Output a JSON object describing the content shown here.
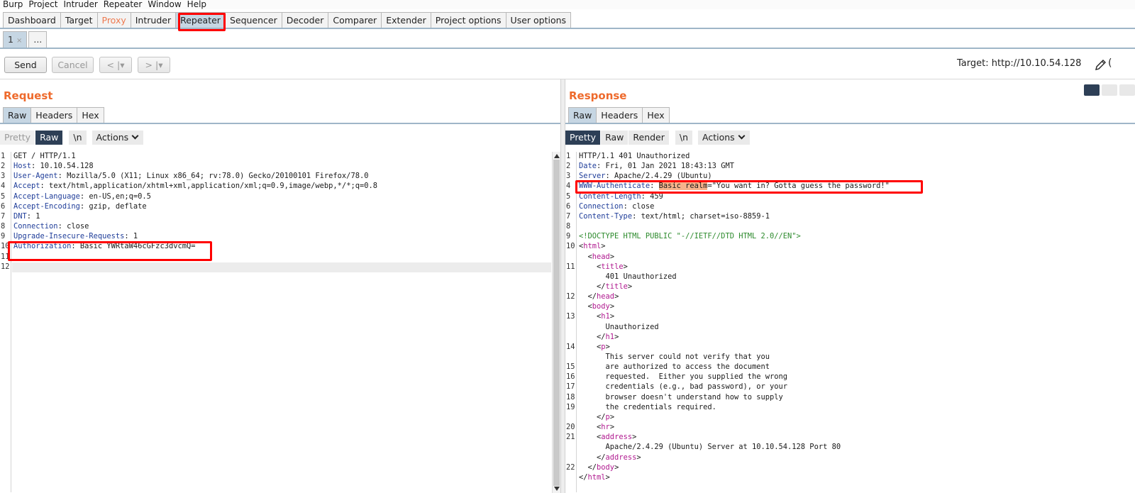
{
  "menubar": [
    "Burp",
    "Project",
    "Intruder",
    "Repeater",
    "Window",
    "Help"
  ],
  "main_tabs": [
    "Dashboard",
    "Target",
    "Proxy",
    "Intruder",
    "Repeater",
    "Sequencer",
    "Decoder",
    "Comparer",
    "Extender",
    "Project options",
    "User options"
  ],
  "sub_tabs": {
    "first": "1",
    "first_close": "×",
    "more": "..."
  },
  "toolbar": {
    "send": "Send",
    "cancel": "Cancel",
    "back": "< |▾",
    "forward": "> |▾",
    "target": "Target: http://10.10.54.128",
    "paren": "("
  },
  "request": {
    "title": "Request",
    "tabs": [
      "Raw",
      "Headers",
      "Hex"
    ],
    "view": {
      "pretty": "Pretty",
      "raw": "Raw",
      "newline": "\\n",
      "actions": "Actions"
    },
    "lines": [
      {
        "n": "1",
        "k": "",
        "v": "GET / HTTP/1.1"
      },
      {
        "n": "2",
        "k": "Host",
        "v": ": 10.10.54.128"
      },
      {
        "n": "3",
        "k": "User-Agent",
        "v": ": Mozilla/5.0 (X11; Linux x86_64; rv:78.0) Gecko/20100101 Firefox/78.0"
      },
      {
        "n": "4",
        "k": "Accept",
        "v": ": text/html,application/xhtml+xml,application/xml;q=0.9,image/webp,*/*;q=0.8"
      },
      {
        "n": "5",
        "k": "Accept-Language",
        "v": ": en-US,en;q=0.5"
      },
      {
        "n": "6",
        "k": "Accept-Encoding",
        "v": ": gzip, deflate"
      },
      {
        "n": "7",
        "k": "DNT",
        "v": ": 1"
      },
      {
        "n": "8",
        "k": "Connection",
        "v": ": close"
      },
      {
        "n": "9",
        "k": "Upgrade-Insecure-Requests",
        "v": ": 1"
      },
      {
        "n": "10",
        "k": "Authorization",
        "v": ": Basic YWRtaW46cGFzc3dvcmQ="
      },
      {
        "n": "11",
        "k": "",
        "v": ""
      },
      {
        "n": "12",
        "k": "",
        "v": ""
      }
    ]
  },
  "response": {
    "title": "Response",
    "tabs": [
      "Raw",
      "Headers",
      "Hex"
    ],
    "view": {
      "pretty": "Pretty",
      "raw": "Raw",
      "render": "Render",
      "newline": "\\n",
      "actions": "Actions"
    },
    "lines": [
      {
        "n": "1",
        "k": "",
        "v": "HTTP/1.1 401 Unauthorized"
      },
      {
        "n": "2",
        "k": "Date",
        "v": ": Fri, 01 Jan 2021 18:43:13 GMT"
      },
      {
        "n": "3",
        "k": "Server",
        "v": ": Apache/2.4.29 (Ubuntu)"
      },
      {
        "n": "4",
        "k": "WWW-Authenticate",
        "v": ": ",
        "mark": "Basic realm",
        "rest": "=\"You want in? Gotta guess the password!\""
      },
      {
        "n": "5",
        "k": "Content-Length",
        "v": ": 459"
      },
      {
        "n": "6",
        "k": "Connection",
        "v": ": close"
      },
      {
        "n": "7",
        "k": "Content-Type",
        "v": ": text/html; charset=iso-8859-1"
      },
      {
        "n": "8",
        "k": "",
        "v": ""
      },
      {
        "n": "9",
        "doc": "<!DOCTYPE HTML PUBLIC \"-//IETF//DTD HTML 2.0//EN\">"
      },
      {
        "n": "10",
        "ind": "",
        "open": "html"
      },
      {
        "n": "",
        "ind": "  ",
        "open": "head"
      },
      {
        "n": "11",
        "ind": "    ",
        "open": "title"
      },
      {
        "n": "",
        "ind": "      ",
        "text": "401 Unauthorized"
      },
      {
        "n": "",
        "ind": "    ",
        "close": "title"
      },
      {
        "n": "12",
        "ind": "  ",
        "close": "head"
      },
      {
        "n": "",
        "ind": "  ",
        "open": "body"
      },
      {
        "n": "13",
        "ind": "    ",
        "open": "h1"
      },
      {
        "n": "",
        "ind": "      ",
        "text": "Unauthorized"
      },
      {
        "n": "",
        "ind": "    ",
        "close": "h1"
      },
      {
        "n": "14",
        "ind": "    ",
        "open": "p"
      },
      {
        "n": "",
        "ind": "      ",
        "text": "This server could not verify that you"
      },
      {
        "n": "15",
        "ind": "      ",
        "text": "are authorized to access the document"
      },
      {
        "n": "16",
        "ind": "      ",
        "text": "requested.  Either you supplied the wrong"
      },
      {
        "n": "17",
        "ind": "      ",
        "text": "credentials (e.g., bad password), or your"
      },
      {
        "n": "18",
        "ind": "      ",
        "text": "browser doesn't understand how to supply"
      },
      {
        "n": "19",
        "ind": "      ",
        "text": "the credentials required."
      },
      {
        "n": "",
        "ind": "    ",
        "close": "p"
      },
      {
        "n": "20",
        "ind": "    ",
        "open": "hr"
      },
      {
        "n": "21",
        "ind": "    ",
        "open": "address"
      },
      {
        "n": "",
        "ind": "      ",
        "text": "Apache/2.4.29 (Ubuntu) Server at 10.10.54.128 Port 80"
      },
      {
        "n": "",
        "ind": "    ",
        "close": "address"
      },
      {
        "n": "22",
        "ind": "  ",
        "close": "body"
      },
      {
        "n": "",
        "ind": "",
        "close": "html"
      }
    ]
  },
  "colors": {
    "accent": "#ee6a2c",
    "highlight": "#ff0000",
    "active_tab": "#c6d6e3",
    "header_key": "#1f3d99",
    "html_tag": "#b0198f"
  }
}
